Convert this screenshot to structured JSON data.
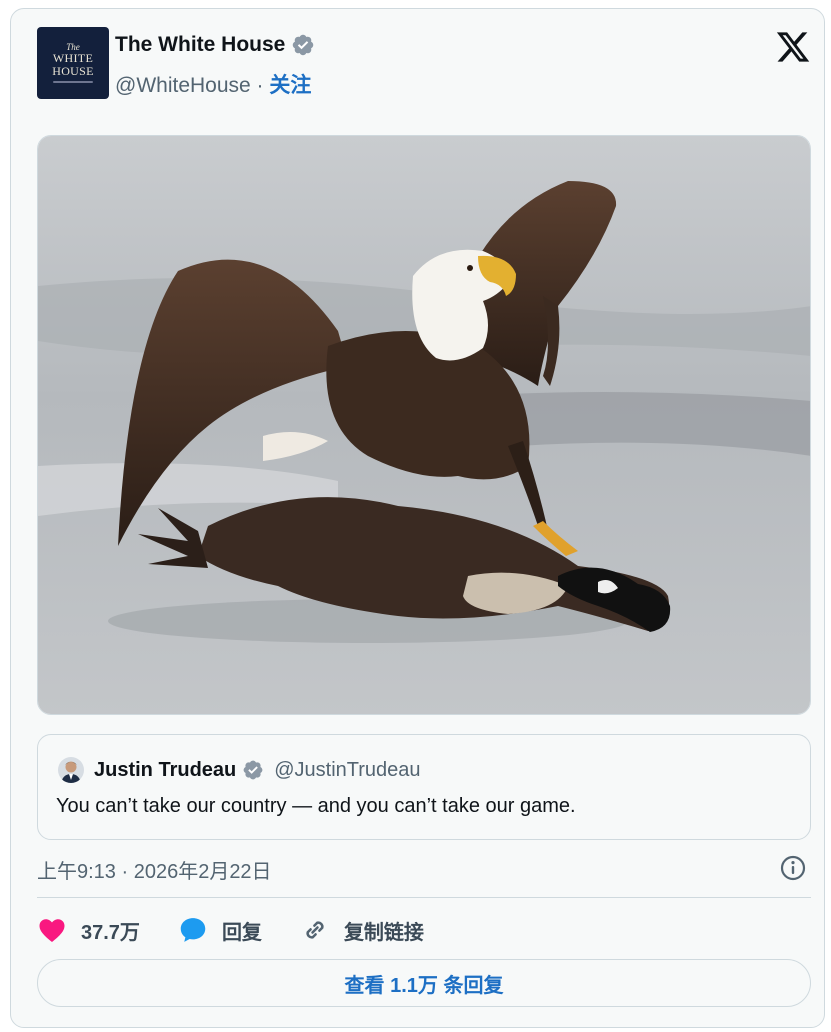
{
  "tweet": {
    "author": {
      "avatar_lines": [
        "The",
        "WHITE",
        "HOUSE"
      ],
      "display_name": "The White House",
      "handle": "@WhiteHouse",
      "separator": "·",
      "follow_label": "关注",
      "verified_icon": "verified-badge-icon"
    },
    "platform_icon": "x-logo-icon",
    "image": {
      "description_icon": "eagle-goose-photo"
    },
    "quoted": {
      "display_name": "Justin Trudeau",
      "handle": "@JustinTrudeau",
      "text": "You can’t take our country — and you can’t take our game."
    },
    "timestamp": "上午9:13 · 2026年2月22日",
    "actions": {
      "likes": "37.7万",
      "reply_label": "回复",
      "copy_link_label": "复制链接"
    },
    "replies_button": "查看 1.1万 条回复"
  },
  "colors": {
    "accent": "#1d6fc4",
    "verified": "#8b98a5",
    "heart": "#f91880",
    "bubble": "#1d9bf0",
    "muted": "#536471"
  }
}
